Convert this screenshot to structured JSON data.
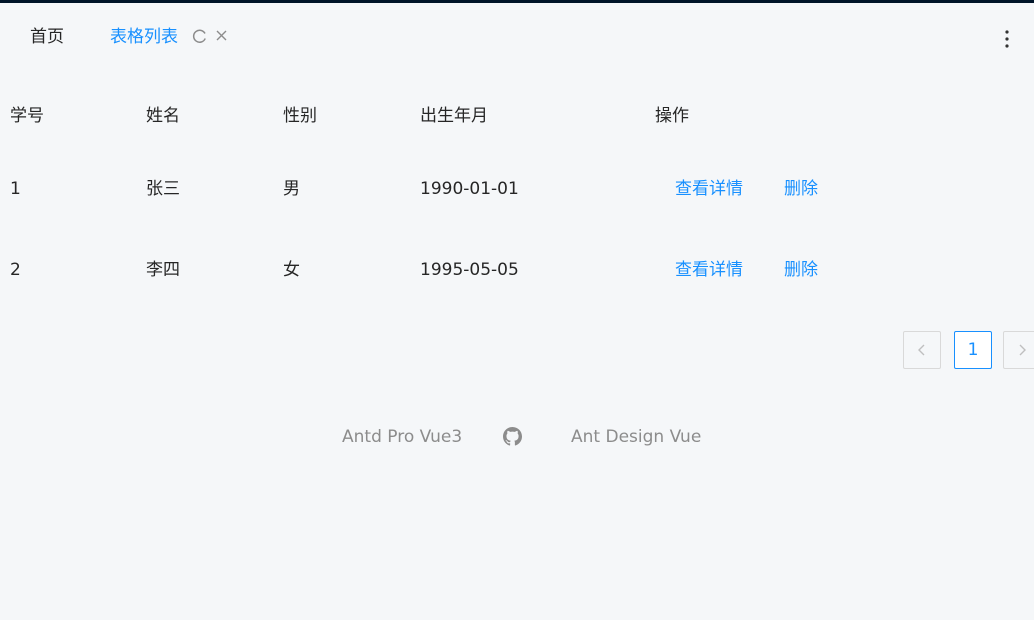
{
  "tabs": {
    "home_label": "首页",
    "active_label": "表格列表"
  },
  "table": {
    "headers": [
      "学号",
      "姓名",
      "性别",
      "出生年月",
      "操作"
    ],
    "rows": [
      {
        "id": "1",
        "name": "张三",
        "gender": "男",
        "birth": "1990-01-01",
        "view": "查看详情",
        "delete": "删除"
      },
      {
        "id": "2",
        "name": "李四",
        "gender": "女",
        "birth": "1995-05-05",
        "view": "查看详情",
        "delete": "删除"
      }
    ]
  },
  "pagination": {
    "current": "1"
  },
  "footer": {
    "link1": "Antd Pro Vue3",
    "link2": "Ant Design Vue"
  },
  "colors": {
    "accent": "#1890ff",
    "topbar": "#001529",
    "background": "#f5f7f9"
  },
  "icons": {
    "reload": "reload-icon",
    "close": "close-icon",
    "more": "more-vertical-icon",
    "github": "github-icon",
    "prev": "chevron-left-icon",
    "next": "chevron-right-icon"
  }
}
